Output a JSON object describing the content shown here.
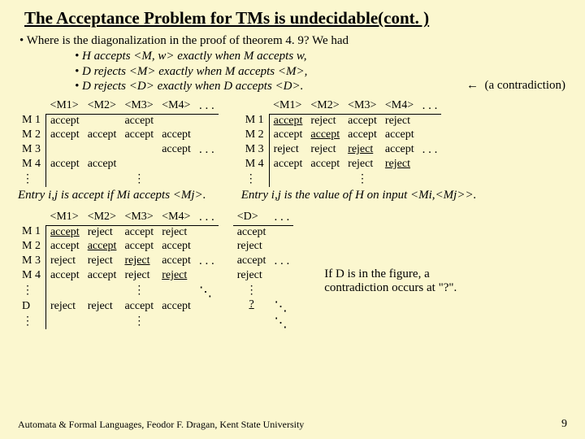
{
  "title": "The Acceptance Problem for TMs is undecidable(cont. )",
  "bullets": {
    "lead": "• Where is the diagonalization in the proof of theorem 4. 9?  We had",
    "items": [
      "• H accepts <M, w> exactly when M accepts w,",
      "• D rejects <M> exactly when M accepts <M>,",
      "• D rejects <D> exactly when D accepts <D>."
    ]
  },
  "contradiction": {
    "arrow": "←",
    "text": "(a contradiction)"
  },
  "headerLabels": {
    "m1": "<M1>",
    "m2": "<M2>",
    "m3": "<M3>",
    "m4": "<M4>",
    "d": "<D>"
  },
  "rowLabels": {
    "m1": "M 1",
    "m2": "M 2",
    "m3": "M 3",
    "m4": "M 4",
    "d": "D"
  },
  "tableA": {
    "rows": [
      [
        "accept",
        "",
        "accept",
        ""
      ],
      [
        "accept",
        "accept",
        "accept",
        "accept"
      ],
      [
        "",
        "",
        "",
        "accept"
      ],
      [
        "accept",
        "accept",
        "",
        ""
      ]
    ],
    "caption": "Entry i,j is accept if Mi accepts <Mj>."
  },
  "tableB": {
    "rows": [
      [
        "accept",
        "reject",
        "accept",
        "reject"
      ],
      [
        "accept",
        "accept",
        "accept",
        "accept"
      ],
      [
        "reject",
        "reject",
        "reject",
        "accept"
      ],
      [
        "accept",
        "accept",
        "reject",
        "reject"
      ]
    ],
    "caption": "Entry i,j is the value of H on input <Mi,<Mj>>."
  },
  "tableC": {
    "rows": [
      [
        "accept",
        "reject",
        "accept",
        "reject"
      ],
      [
        "accept",
        "accept",
        "accept",
        "accept"
      ],
      [
        "reject",
        "reject",
        "reject",
        "accept"
      ],
      [
        "accept",
        "accept",
        "reject",
        "reject"
      ]
    ],
    "drow": [
      "reject",
      "reject",
      "accept",
      "accept"
    ]
  },
  "tableD": {
    "col": [
      "accept",
      "reject",
      "accept",
      "reject"
    ],
    "q": "?"
  },
  "note": "If D is in the figure, a contradiction occurs at \"?\".",
  "ellipsis": ". . .",
  "vell": "⋮",
  "ddots": "⋱",
  "footer": "Automata & Formal Languages, Feodor F. Dragan, Kent State University",
  "page": "9"
}
